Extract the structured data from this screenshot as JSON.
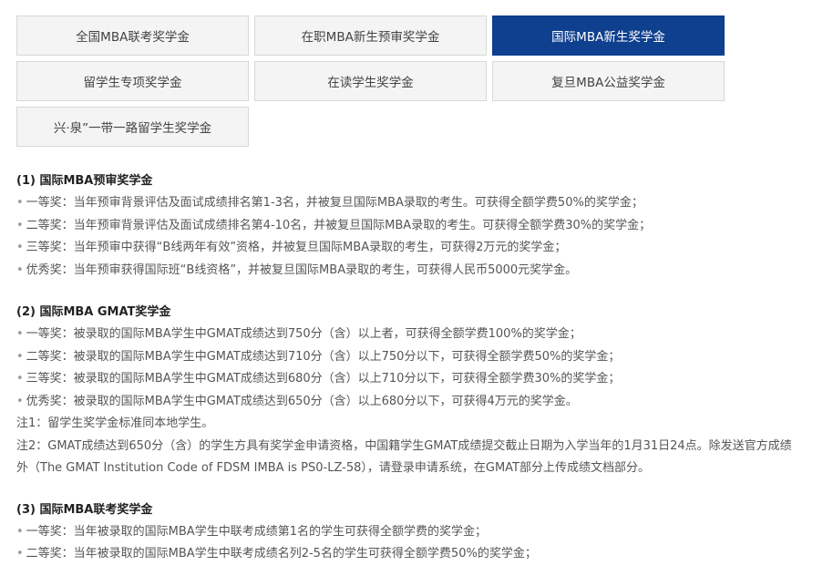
{
  "tabs": [
    {
      "label": "全国MBA联考奖学金",
      "active": false
    },
    {
      "label": "在职MBA新生预审奖学金",
      "active": false
    },
    {
      "label": "国际MBA新生奖学金",
      "active": true
    },
    {
      "label": "留学生专项奖学金",
      "active": false
    },
    {
      "label": "在读学生奖学金",
      "active": false
    },
    {
      "label": "复旦MBA公益奖学金",
      "active": false
    },
    {
      "label": "兴·泉”一带一路留学生奖学金",
      "active": false
    }
  ],
  "colors": {
    "active_tab": "#0f3f8f",
    "tab_bg": "#f4f4f4"
  },
  "bullet": "•",
  "sections": [
    {
      "title": "(1) 国际MBA预审奖学金",
      "items": [
        "一等奖：当年预审背景评估及面试成绩排名第1-3名，并被复旦国际MBA录取的考生。可获得全额学费50%的奖学金；",
        "二等奖：当年预审背景评估及面试成绩排名第4-10名，并被复旦国际MBA录取的考生。可获得全额学费30%的奖学金；",
        "三等奖：当年预审中获得“B线两年有效”资格，并被复旦国际MBA录取的考生，可获得2万元的奖学金；",
        "优秀奖：当年预审获得国际班“B线资格”，并被复旦国际MBA录取的考生，可获得人民币5000元奖学金。"
      ]
    },
    {
      "title": "(2) 国际MBA GMAT奖学金",
      "items": [
        "一等奖：被录取的国际MBA学生中GMAT成绩达到750分（含）以上者，可获得全额学费100%的奖学金；",
        "二等奖：被录取的国际MBA学生中GMAT成绩达到710分（含）以上750分以下，可获得全额学费50%的奖学金；",
        "三等奖：被录取的国际MBA学生中GMAT成绩达到680分（含）以上710分以下，可获得全额学费30%的奖学金；",
        "优秀奖：被录取的国际MBA学生中GMAT成绩达到650分（含）以上680分以下，可获得4万元的奖学金。"
      ],
      "note1": "注1：留学生奖学金标准同本地学生。",
      "note2": "注2：GMAT成绩达到650分（含）的学生方具有奖学金申请资格，中国籍学生GMAT成绩提交截止日期为入学当年的1月31日24点。除发送官方成绩 外（The GMAT Institution Code of FDSM IMBA is PS0-LZ-58），请登录申请系统，在GMAT部分上传成绩文档部分。"
    },
    {
      "title": "(3) 国际MBA联考奖学金",
      "items": [
        "一等奖：当年被录取的国际MBA学生中联考成绩第1名的学生可获得全额学费的奖学金；",
        "二等奖：当年被录取的国际MBA学生中联考成绩名列2-5名的学生可获得全额学费50%的奖学金；"
      ]
    }
  ]
}
